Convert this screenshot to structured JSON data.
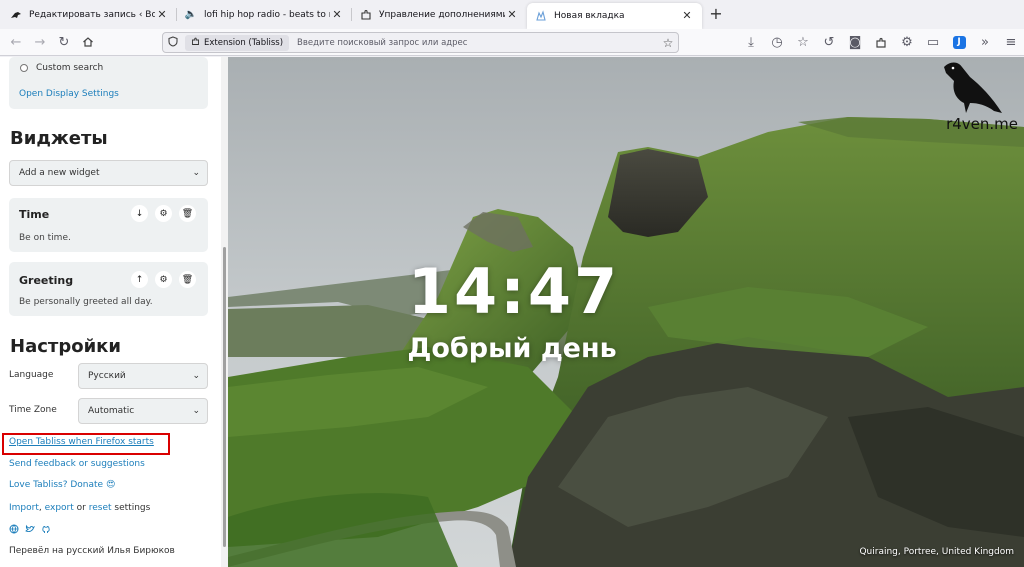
{
  "tabs": [
    {
      "title": "Редактировать запись ‹ Воронин",
      "icon": "raven-icon",
      "active": false
    },
    {
      "title": "lofi hip hop radio - beats to relax/st",
      "icon": "speaker-icon",
      "active": false
    },
    {
      "title": "Управление дополнениями",
      "icon": "puzzle-icon",
      "active": false
    },
    {
      "title": "Новая вкладка",
      "icon": "tabliss-icon",
      "active": true
    }
  ],
  "urlbar": {
    "extension_label": "Extension (Tabliss)",
    "placeholder": "Введите поисковый запрос или адрес"
  },
  "sidebar": {
    "custom_search": "Custom search",
    "open_display_settings": "Open Display Settings",
    "widgets_heading": "Виджеты",
    "add_widget": "Add a new widget",
    "widgets": [
      {
        "title": "Time",
        "desc": "Be on time."
      },
      {
        "title": "Greeting",
        "desc": "Be personally greeted all day."
      }
    ],
    "settings_heading": "Настройки",
    "language_label": "Language",
    "language_value": "Русский",
    "timezone_label": "Time Zone",
    "timezone_value": "Automatic",
    "open_tabliss": "Open Tabliss when Firefox starts",
    "feedback": "Send feedback or suggestions",
    "love": "Love Tabliss? Donate",
    "love_emoji": "😍",
    "import": "Import",
    "comma": ",",
    "export": "export",
    "or": "or",
    "reset": "reset",
    "settings_word": "settings",
    "translator": "Перевёл на русский Илья Бирюков"
  },
  "main": {
    "time": "14:47",
    "greeting": "Добрый день",
    "photo_credit": "Quiraing, Portree, United Kingdom",
    "watermark": "r4ven.me"
  },
  "colors": {
    "link": "#1c7ebb",
    "highlight": "#d90000",
    "card": "#eef1f2"
  }
}
